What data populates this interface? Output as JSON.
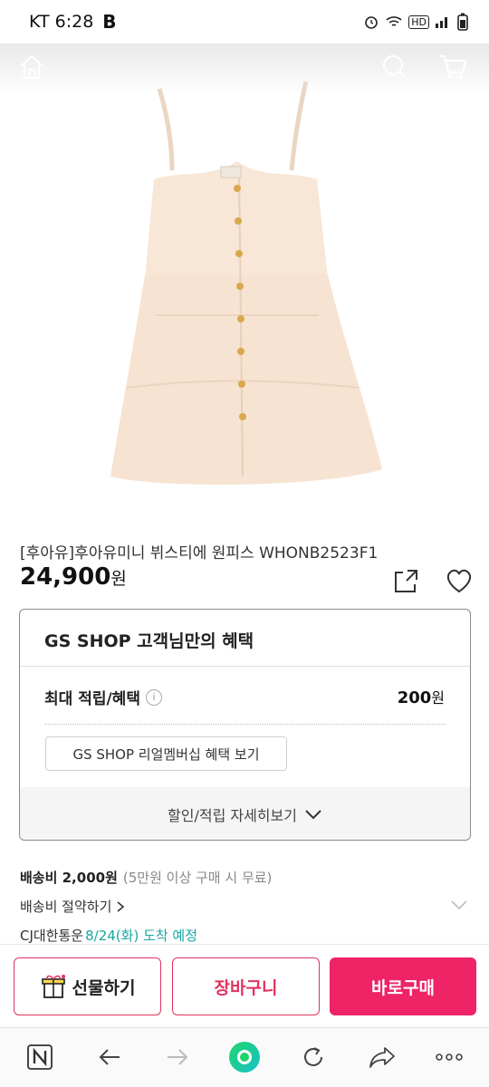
{
  "status_bar": {
    "carrier_time": "KT 6:28",
    "app_badge": "B",
    "network": "HD"
  },
  "top_nav": {
    "home_icon": "home-icon",
    "search_icon": "search-icon",
    "cart_icon": "cart-icon"
  },
  "product": {
    "name": "[후아유]후아유미니 뷔스티에 원피스 WHONB2523F1",
    "price": "24,900",
    "price_unit": "원"
  },
  "benefit": {
    "title": "GS SHOP 고객님만의 혜택",
    "reward_label": "최대 적립/혜택",
    "reward_info_icon": "i",
    "reward_value": "200",
    "reward_unit": "원",
    "membership_button": "GS SHOP 리얼멤버십 혜택 보기",
    "detail_toggle": "할인/적립 자세히보기"
  },
  "shipping": {
    "fee_label": "배송비 2,000원",
    "fee_note": "(5만원 이상 구매 시 무료)",
    "save_link": "배송비 절약하기",
    "carrier": "CJ대한통운",
    "arrival": "8/24(화) 도착 예정"
  },
  "actions": {
    "gift": "선물하기",
    "add_to_cart": "장바구니",
    "buy_now": "바로구매"
  },
  "colors": {
    "accent": "#ee2466",
    "border_accent": "#e1325f",
    "arrival_teal": "#18a6a0"
  }
}
